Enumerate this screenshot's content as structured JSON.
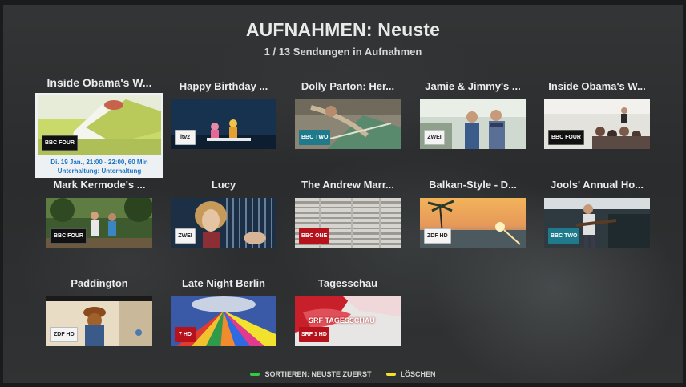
{
  "header": {
    "title": "AUFNAHMEN: Neuste",
    "subtitle": "1 / 13 Sendungen in Aufnahmen"
  },
  "focused": {
    "meta_line1": "Di. 19 Jan., 21:00 - 22:00, 60 Min",
    "meta_line2": "Unterhaltung: Unterhaltung"
  },
  "recordings": [
    {
      "title": "Inside Obama's W...",
      "channel": "BBC FOUR"
    },
    {
      "title": "Happy Birthday ...",
      "channel": "itv2"
    },
    {
      "title": "Dolly Parton: Her...",
      "channel": "BBC TWO"
    },
    {
      "title": "Jamie & Jimmy's ...",
      "channel": "ZWEI"
    },
    {
      "title": "Inside Obama's W...",
      "channel": "BBC FOUR"
    },
    {
      "title": "Mark Kermode's ...",
      "channel": "BBC FOUR"
    },
    {
      "title": "Lucy",
      "channel": "ZWEI"
    },
    {
      "title": "The Andrew Marr...",
      "channel": "BBC ONE"
    },
    {
      "title": "Balkan-Style - D...",
      "channel": "ZDF HD"
    },
    {
      "title": "Jools' Annual Ho...",
      "channel": "BBC TWO"
    },
    {
      "title": "Paddington",
      "channel": "ZDF HD"
    },
    {
      "title": "Late Night Berlin",
      "channel": "7 HD"
    },
    {
      "title": "Tagesschau",
      "channel": "SRF 1 HD",
      "thumb_text": "SRF TAGESSCHAU"
    }
  ],
  "footer": {
    "sort_label": "SORTIEREN: NEUSTE ZUERST",
    "delete_label": "LÖSCHEN",
    "green": "#2ecc40",
    "yellow": "#f5e02a"
  }
}
